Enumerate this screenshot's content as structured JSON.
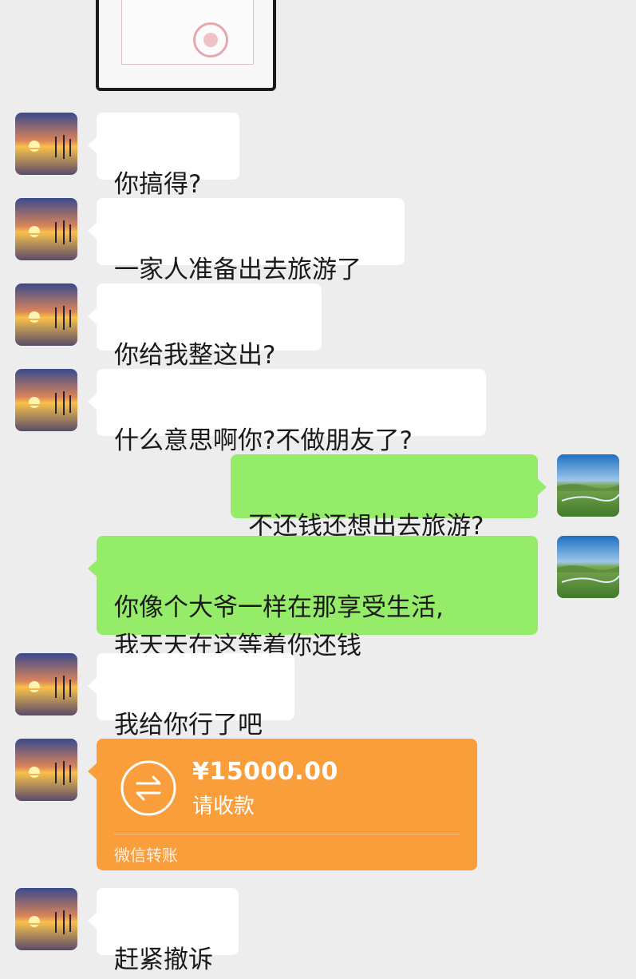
{
  "messages": [
    {
      "side": "left",
      "type": "image",
      "avatar": "sunset-avatar"
    },
    {
      "side": "left",
      "type": "text",
      "text": "你搞得?"
    },
    {
      "side": "left",
      "type": "text",
      "text": "一家人准备出去旅游了"
    },
    {
      "side": "left",
      "type": "text",
      "text": "你给我整这出?"
    },
    {
      "side": "left",
      "type": "text",
      "text": "什么意思啊你?不做朋友了?"
    },
    {
      "side": "right",
      "type": "text",
      "text": "不还钱还想出去旅游?"
    },
    {
      "side": "right",
      "type": "text",
      "text": "你像个大爷一样在那享受生活,\n我天天在这等着你还钱"
    },
    {
      "side": "left",
      "type": "text",
      "text": "我给你行了吧"
    },
    {
      "side": "left",
      "type": "transfer",
      "amount": "¥15000.00",
      "subtitle": "请收款",
      "footer": "微信转账"
    },
    {
      "side": "left",
      "type": "text",
      "text": "赶紧撤诉"
    }
  ],
  "colors": {
    "background": "#ededed",
    "bubble_other": "#ffffff",
    "bubble_self": "#95ec69",
    "transfer": "#fa9d3b"
  },
  "icons": {
    "other_avatar": "sunset-pier-photo",
    "self_avatar": "grassland-landscape-photo",
    "transfer_icon": "exchange-arrows-icon"
  }
}
